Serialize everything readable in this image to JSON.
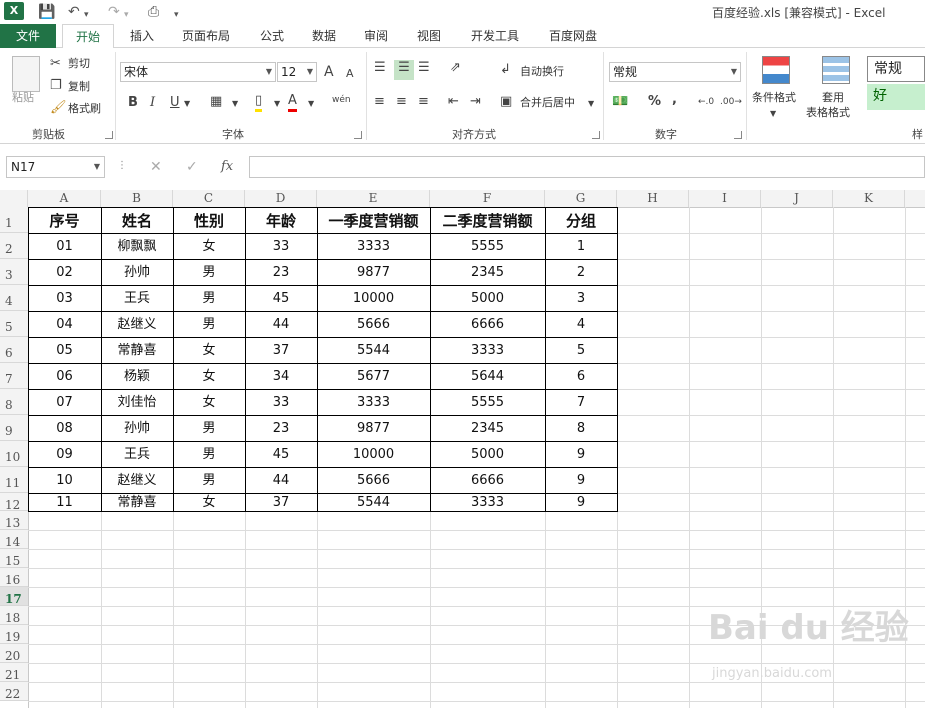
{
  "window": {
    "title": "百度经验.xls  [兼容模式] - Excel",
    "logo": "X"
  },
  "quick_access": {
    "save_icon": "save-icon",
    "undo_icon": "undo-icon",
    "redo_icon": "redo-icon",
    "preview_icon": "print-preview-icon"
  },
  "tabs": [
    "文件",
    "开始",
    "插入",
    "页面布局",
    "公式",
    "数据",
    "审阅",
    "视图",
    "开发工具",
    "百度网盘"
  ],
  "ribbon": {
    "clipboard": {
      "paste": "粘贴",
      "cut": "剪切",
      "copy": "复制",
      "format_painter": "格式刷",
      "label": "剪贴板"
    },
    "font": {
      "name": "宋体",
      "size": "12",
      "grow": "A",
      "shrink": "A",
      "bold": "B",
      "italic": "I",
      "underline": "U",
      "phonetic": "wén",
      "label": "字体"
    },
    "alignment": {
      "wrap": "自动换行",
      "merge": "合并后居中",
      "label": "对齐方式"
    },
    "number": {
      "format": "常规",
      "percent": "%",
      "comma": ",",
      "label": "数字"
    },
    "styles": {
      "conditional": "条件格式",
      "table_line1": "套用",
      "table_line2": "表格格式",
      "normal": "常规",
      "good": "好",
      "label": "样"
    }
  },
  "formula_bar": {
    "name_box": "N17",
    "fx": "fx",
    "value": ""
  },
  "columns": [
    "A",
    "B",
    "C",
    "D",
    "E",
    "F",
    "G",
    "H",
    "I",
    "J",
    "K"
  ],
  "rows": [
    "1",
    "2",
    "3",
    "4",
    "5",
    "6",
    "7",
    "8",
    "9",
    "10",
    "11",
    "12",
    "13",
    "14",
    "15",
    "16",
    "17",
    "18",
    "19",
    "20",
    "21",
    "22"
  ],
  "selected_row": "17",
  "table": {
    "headers": [
      "序号",
      "姓名",
      "性别",
      "年龄",
      "一季度营销额",
      "二季度营销额",
      "分组"
    ],
    "data": [
      [
        "01",
        "柳飘飘",
        "女",
        "33",
        "3333",
        "5555",
        "1"
      ],
      [
        "02",
        "孙帅",
        "男",
        "23",
        "9877",
        "2345",
        "2"
      ],
      [
        "03",
        "王兵",
        "男",
        "45",
        "10000",
        "5000",
        "3"
      ],
      [
        "04",
        "赵继义",
        "男",
        "44",
        "5666",
        "6666",
        "4"
      ],
      [
        "05",
        "常静喜",
        "女",
        "37",
        "5544",
        "3333",
        "5"
      ],
      [
        "06",
        "杨颖",
        "女",
        "34",
        "5677",
        "5644",
        "6"
      ],
      [
        "07",
        "刘佳怡",
        "女",
        "33",
        "3333",
        "5555",
        "7"
      ],
      [
        "08",
        "孙帅",
        "男",
        "23",
        "9877",
        "2345",
        "8"
      ],
      [
        "09",
        "王兵",
        "男",
        "45",
        "10000",
        "5000",
        "9"
      ],
      [
        "10",
        "赵继义",
        "男",
        "44",
        "5666",
        "6666",
        "9"
      ],
      [
        "11",
        "常静喜",
        "女",
        "37",
        "5544",
        "3333",
        "9"
      ]
    ]
  },
  "watermark": {
    "main": "Bai du 经验",
    "sub": "jingyan.baidu.com"
  }
}
